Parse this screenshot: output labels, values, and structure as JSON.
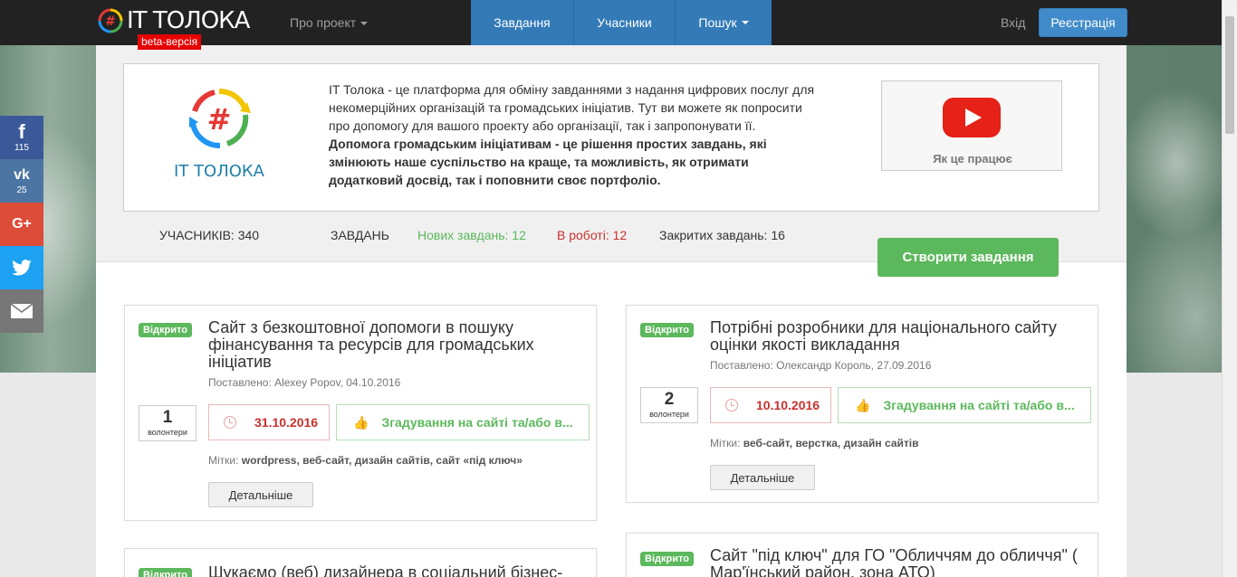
{
  "navbar": {
    "brand": "IT ТОЛОКА",
    "beta": "beta-версія",
    "about": "Про проект",
    "tabs": [
      "Завдання",
      "Учасники",
      "Пошук"
    ],
    "login": "Вхід",
    "register": "Реєстрація"
  },
  "social": {
    "facebook_count": "115",
    "vk_count": "25"
  },
  "intro": {
    "text_plain": "IT Толока - це платформа для обміну завданнями з надання цифрових послуг для некомерційних організацій та громадських ініціатив. Тут ви можете як попросити про допомогу для вашого проекту або організації, так і запропонувати її. ",
    "text_bold": "Допомога громадським ініціативам - це рішення простих завдань, які змінюють наше суспільство на краще, та можливість, як отримати додатковий досвід, так і поповнити своє портфоліо.",
    "logo_text": "IT ТОЛОКА",
    "video_label": "Як це працює"
  },
  "stats": {
    "members": "УЧАСНИКІВ: 340",
    "tasks": "ЗАВДАНЬ",
    "new_tasks": "Нових завдань: 12",
    "in_progress": "В роботі: 12",
    "closed": "Закритих завдань: 16"
  },
  "create_button": "Створити завдання",
  "tasks": [
    {
      "status": "Відкрито",
      "title": "Сайт з безкоштовної допомоги в пошуку фінансування та ресурсів для громадських ініціатив",
      "posted": "Поставлено: Alexey Popov, 04.10.2016",
      "volunteers": "1",
      "volunteers_label": "волонтери",
      "deadline": "31.10.2016",
      "reward": "Згадування на сайті та/або в...",
      "tags_label": "Мітки:",
      "tags": "wordpress, веб-сайт, дизайн сайтів, сайт «під ключ»",
      "more": "Детальніше"
    },
    {
      "status": "Відкрито",
      "title": "Потрібні розробники для національного сайту оцінки якості викладання",
      "posted": "Поставлено: Олександр Король, 27.09.2016",
      "volunteers": "2",
      "volunteers_label": "волонтери",
      "deadline": "10.10.2016",
      "reward": "Згадування на сайті та/або в...",
      "tags_label": "Мітки:",
      "tags": "веб-сайт, верстка, дизайн сайтів",
      "more": "Детальніше"
    },
    {
      "status": "Відкрито",
      "title": "Шукаємо (веб) дизайнера в соціальний бізнес-"
    },
    {
      "status": "Відкрито",
      "title": "Сайт \"під ключ\" для ГО \"Обличчям до обличчя\" ( Мар'їнський район, зона АТО)"
    }
  ],
  "colors": {
    "navbar": "#222222",
    "accent_blue": "#337ab7",
    "success_green": "#5cb85c",
    "danger_red": "#c9302c"
  }
}
